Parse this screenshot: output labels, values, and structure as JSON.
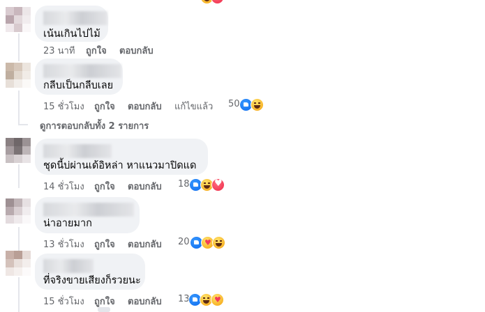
{
  "comments": [
    {
      "text": "เน้นเกินไปไม้",
      "time": "23 นาที",
      "like": "ถูกใจ",
      "reply": "ตอบกลับ",
      "edited": "",
      "reaction_count": "",
      "reactions": []
    },
    {
      "text": "กลีบเป็นกลีบเลย",
      "time": "15 ชั่วโมง",
      "like": "ถูกใจ",
      "reply": "ตอบกลับ",
      "edited": "แก้ไขแล้ว",
      "reaction_count": "50",
      "reactions": [
        "like-icon",
        "haha-icon"
      ]
    },
    {
      "text": "ชุดนี้บ่ผ่านเด้อิหล่า หาแนวมาปิดแด",
      "time": "14 ชั่วโมง",
      "like": "ถูกใจ",
      "reply": "ตอบกลับ",
      "edited": "",
      "reaction_count": "18",
      "reactions": [
        "like-icon",
        "haha-icon",
        "love-icon"
      ]
    },
    {
      "text": "น่าอายมาก",
      "time": "13 ชั่วโมง",
      "like": "ถูกใจ",
      "reply": "ตอบกลับ",
      "edited": "",
      "reaction_count": "20",
      "reactions": [
        "like-icon",
        "care-icon",
        "haha-icon"
      ]
    },
    {
      "text": "ที่จริงขายเสียงก็รวยนะ",
      "time": "15 ชั่วโมง",
      "like": "ถูกใจ",
      "reply": "ตอบกลับ",
      "edited": "",
      "reaction_count": "13",
      "reactions": [
        "like-icon",
        "haha-icon",
        "care-icon"
      ]
    }
  ],
  "view_replies": "ดูการตอบกลับทั้ง 2 รายการ",
  "colors": {
    "bubble": "#f0f2f5",
    "meta_text": "#65676b",
    "like_blue": "#1877f2",
    "love_red": "#f33e58",
    "haha_yellow": "#f7b125"
  }
}
